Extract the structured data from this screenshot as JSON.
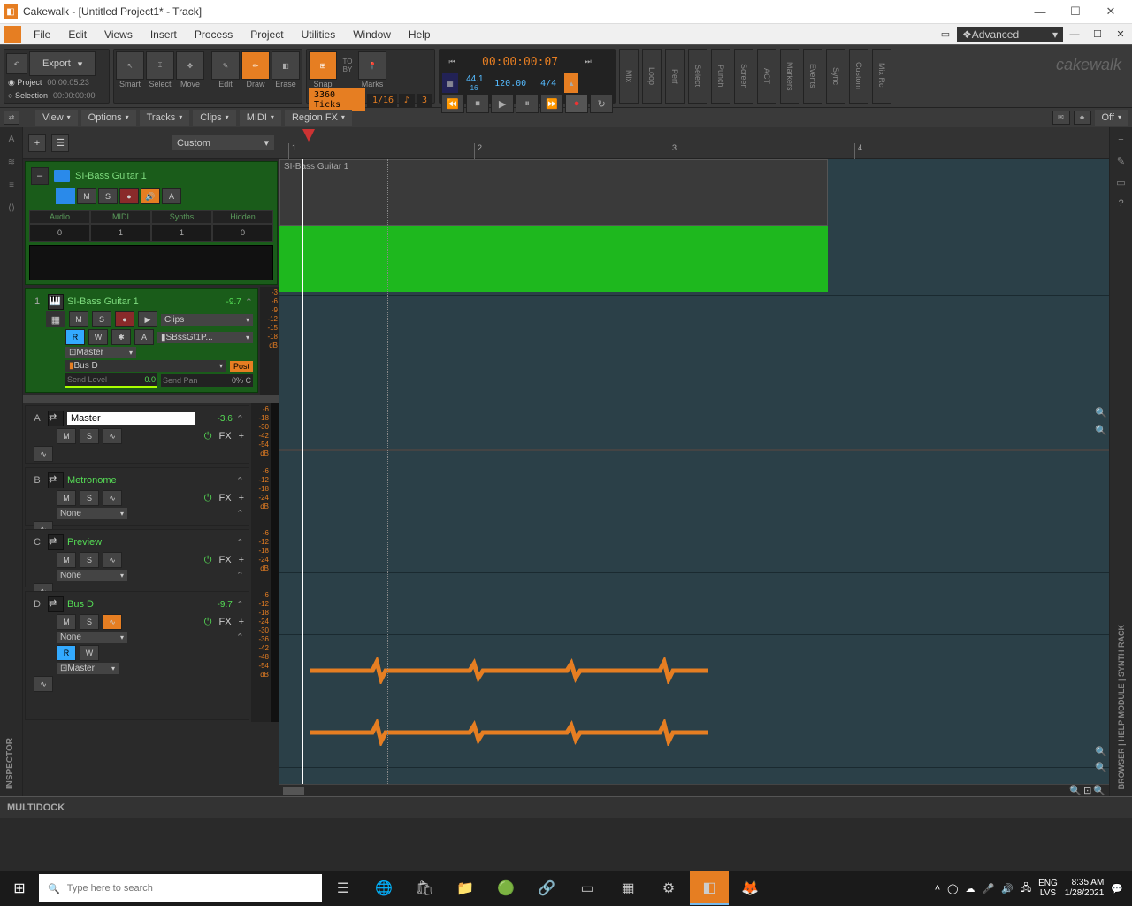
{
  "window": {
    "title": "Cakewalk - [Untitled Project1* - Track]"
  },
  "menubar": [
    "File",
    "Edit",
    "Views",
    "Insert",
    "Process",
    "Project",
    "Utilities",
    "Window",
    "Help"
  ],
  "workspace_dd": "Advanced",
  "export_btn": "Export",
  "radio": {
    "project": "Project",
    "selection": "Selection"
  },
  "times": {
    "proj": "00:00:05:23",
    "sel": "00:00:00:00"
  },
  "tools": [
    "Smart",
    "Select",
    "Move",
    "Edit",
    "Draw",
    "Erase"
  ],
  "snap": {
    "label": "Snap",
    "ticks": "3360 Ticks",
    "res": "1/16",
    "beat": "3"
  },
  "marker": {
    "to": "TO",
    "by": "BY",
    "label": "Marks"
  },
  "counter": {
    "big": "00:00:00:07",
    "rate": "44.1",
    "bits": "16",
    "tempo": "120.00",
    "sig": "4/4"
  },
  "side_modules": [
    "Mix",
    "Loop",
    "Perf",
    "Select",
    "Punch",
    "Screen",
    "ACT",
    "Markers",
    "Events",
    "Sync",
    "Custom",
    "Mix Rcl"
  ],
  "logo": "cakewalk",
  "viewbar": [
    "View",
    "Options",
    "Tracks",
    "Clips",
    "MIDI",
    "Region FX"
  ],
  "viewbar_right": "Off",
  "preset": "Custom",
  "ruler_marks": [
    "1",
    "2",
    "3",
    "4"
  ],
  "folder": {
    "name": "SI-Bass Guitar 1",
    "stats": {
      "headers": [
        "Audio",
        "MIDI",
        "Synths",
        "Hidden"
      ],
      "values": [
        "0",
        "1",
        "1",
        "0"
      ]
    }
  },
  "track1": {
    "num": "1",
    "name": "SI-Bass Guitar 1",
    "gain": "-9.7",
    "clips_dd": "Clips",
    "patch": "SBssGt1P...",
    "out": "Master",
    "send": "Bus D",
    "post": "Post",
    "sendlvl_label": "Send Level",
    "sendlvl": "0.0",
    "sendpan_label": "Send Pan",
    "sendpan": "0% C"
  },
  "track1_db": [
    "-3",
    "-6",
    "-9",
    "-12",
    "-15",
    "-18",
    "dB"
  ],
  "clip_label": "SI-Bass Guitar 1",
  "buses": [
    {
      "letter": "A",
      "name": "Master",
      "gain": "-3.6",
      "fx": "FX",
      "out": "",
      "db": [
        "-6",
        "-18",
        "-30",
        "-42",
        "-54",
        "dB"
      ]
    },
    {
      "letter": "B",
      "name": "Metronome",
      "gain": "",
      "fx": "FX",
      "out": "None",
      "db": [
        "-6",
        "-12",
        "-18",
        "-24",
        "dB"
      ]
    },
    {
      "letter": "C",
      "name": "Preview",
      "gain": "",
      "fx": "FX",
      "out": "None",
      "db": [
        "-6",
        "-12",
        "-18",
        "-24",
        "dB"
      ]
    },
    {
      "letter": "D",
      "name": "Bus D",
      "gain": "-9.7",
      "fx": "FX",
      "out": "None",
      "out2": "Master",
      "db": [
        "-6",
        "-12",
        "-18",
        "-24",
        "-30",
        "-36",
        "-42",
        "-48",
        "-54",
        "dB"
      ]
    }
  ],
  "multidock": "MULTIDOCK",
  "inspector": "INSPECTOR",
  "browser_labels": "BROWSER  |  HELP MODULE  |  SYNTH RACK",
  "taskbar": {
    "search_ph": "Type here to search",
    "lang": "ENG",
    "kb": "LVS",
    "time": "8:35 AM",
    "date": "1/28/2021"
  }
}
